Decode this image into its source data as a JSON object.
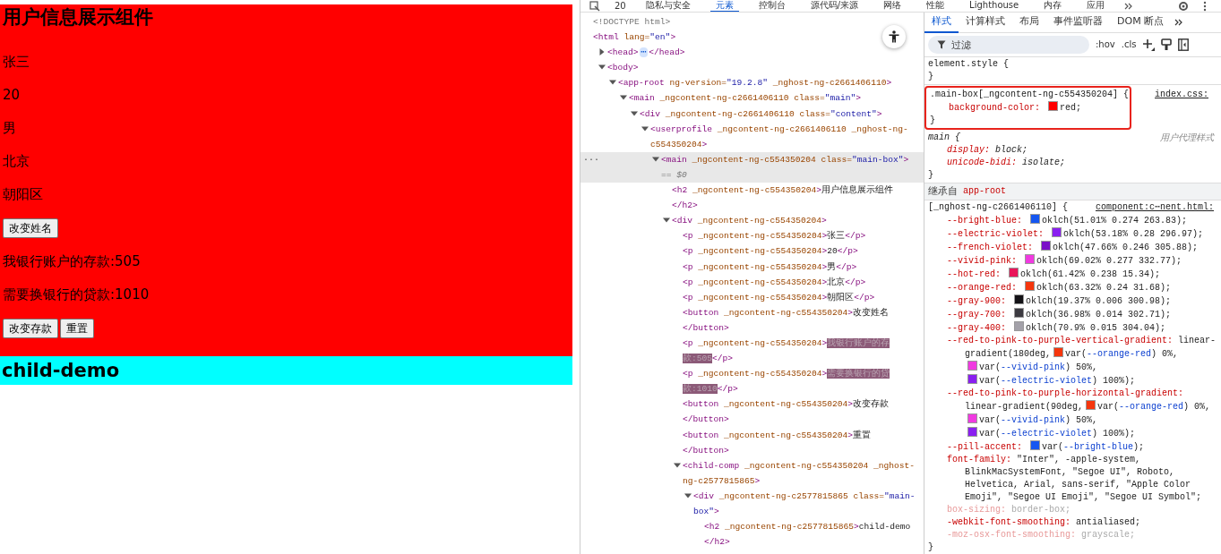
{
  "page": {
    "heading": "用户信息展示组件",
    "content": [
      {
        "kind": "text",
        "text": "张三"
      },
      {
        "kind": "text",
        "text": "20"
      },
      {
        "kind": "text",
        "text": "男"
      },
      {
        "kind": "text",
        "text": "北京"
      },
      {
        "kind": "text",
        "text": "朝阳区"
      },
      {
        "kind": "buttons",
        "buttons": [
          "改变姓名"
        ]
      },
      {
        "kind": "text",
        "text": "我银行账户的存款:505"
      },
      {
        "kind": "text",
        "text": "需要换银行的贷款:1010"
      },
      {
        "kind": "buttons",
        "buttons": [
          "改变存款",
          "重置"
        ]
      }
    ],
    "child": {
      "heading": "child-demo"
    }
  },
  "devtools": {
    "issue_count": "20",
    "tabs": [
      {
        "label": "隐私与安全",
        "selected": false
      },
      {
        "label": "元素",
        "selected": true
      },
      {
        "label": "控制台",
        "selected": false
      },
      {
        "label": "源代码/来源",
        "selected": false
      },
      {
        "label": "网络",
        "selected": false
      },
      {
        "label": "性能",
        "selected": false
      },
      {
        "label": "Lighthouse",
        "selected": false
      },
      {
        "label": "内存",
        "selected": false
      },
      {
        "label": "应用",
        "selected": false
      }
    ]
  },
  "elements": {
    "tree": [
      {
        "selected": false,
        "tokens": [
          {
            "kind": "muted",
            "text": "<!DOCTYPE html>"
          }
        ]
      },
      {
        "selected": false,
        "tokens": [
          {
            "kind": "tag",
            "text": "<html"
          },
          {
            "kind": "attr",
            "text": " lang="
          },
          {
            "kind": "value",
            "text": "\"en\""
          },
          {
            "kind": "tag",
            "text": ">"
          }
        ],
        "children": [
          {
            "selected": false,
            "expanded": false,
            "tokens": [
              {
                "kind": "tag",
                "text": "<head>"
              },
              {
                "kind": "badge",
                "text": "⋯"
              },
              {
                "kind": "tag",
                "text": "</head>"
              }
            ]
          },
          {
            "selected": false,
            "expanded": true,
            "tokens": [
              {
                "kind": "tag",
                "text": "<body>"
              }
            ],
            "children": [
              {
                "selected": false,
                "expanded": true,
                "tokens": [
                  {
                    "kind": "tag",
                    "text": "<app-root"
                  },
                  {
                    "kind": "attr",
                    "text": " ng-version="
                  },
                  {
                    "kind": "value",
                    "text": "\"19.2.8\""
                  },
                  {
                    "kind": "attr",
                    "text": " _nghost-ng-c2661406110"
                  },
                  {
                    "kind": "tag",
                    "text": ">"
                  }
                ],
                "children": [
                  {
                    "selected": false,
                    "expanded": true,
                    "tokens": [
                      {
                        "kind": "tag",
                        "text": "<main"
                      },
                      {
                        "kind": "attr",
                        "text": " _ngcontent-ng-c2661406110 class="
                      },
                      {
                        "kind": "value",
                        "text": "\"main\""
                      },
                      {
                        "kind": "tag",
                        "text": ">"
                      }
                    ],
                    "children": [
                      {
                        "selected": false,
                        "expanded": true,
                        "tokens": [
                          {
                            "kind": "tag",
                            "text": "<div"
                          },
                          {
                            "kind": "attr",
                            "text": " _ngcontent-ng-c2661406110 class="
                          },
                          {
                            "kind": "value",
                            "text": "\"content\""
                          },
                          {
                            "kind": "tag",
                            "text": ">"
                          }
                        ],
                        "children": [
                          {
                            "selected": false,
                            "expanded": true,
                            "tokens": [
                              {
                                "kind": "tag",
                                "text": "<userprofile"
                              },
                              {
                                "kind": "attr",
                                "text": " _ngcontent-ng-c2661406110 _nghost-ng-c554350204"
                              },
                              {
                                "kind": "tag",
                                "text": ">"
                              }
                            ],
                            "children": [
                              {
                                "selected": true,
                                "marker": "···",
                                "expanded": true,
                                "tokens": [
                                  {
                                    "kind": "tag",
                                    "text": "<main"
                                  },
                                  {
                                    "kind": "attr",
                                    "text": " _ngcontent-ng-c554350204 class="
                                  },
                                  {
                                    "kind": "value",
                                    "text": "\"main-box\""
                                  },
                                  {
                                    "kind": "tag",
                                    "text": ">"
                                  },
                                  {
                                    "kind": "ref",
                                    "text": " == $0"
                                  }
                                ],
                                "children": [
                                  {
                                    "selected": false,
                                    "tokens": [
                                      {
                                        "kind": "tag",
                                        "text": "<h2"
                                      },
                                      {
                                        "kind": "attr",
                                        "text": " _ngcontent-ng-c554350204"
                                      },
                                      {
                                        "kind": "tag",
                                        "text": ">"
                                      },
                                      {
                                        "kind": "text",
                                        "text": "用户信息展示组件"
                                      },
                                      {
                                        "kind": "break"
                                      },
                                      {
                                        "kind": "tag",
                                        "text": "</h2>"
                                      }
                                    ]
                                  },
                                  {
                                    "selected": false,
                                    "expanded": true,
                                    "tokens": [
                                      {
                                        "kind": "tag",
                                        "text": "<div"
                                      },
                                      {
                                        "kind": "attr",
                                        "text": " _ngcontent-ng-c554350204"
                                      },
                                      {
                                        "kind": "tag",
                                        "text": ">"
                                      }
                                    ],
                                    "children": [
                                      {
                                        "selected": false,
                                        "tokens": [
                                          {
                                            "kind": "tag",
                                            "text": "<p"
                                          },
                                          {
                                            "kind": "attr",
                                            "text": " _ngcontent-ng-c554350204"
                                          },
                                          {
                                            "kind": "tag",
                                            "text": ">"
                                          },
                                          {
                                            "kind": "text",
                                            "text": "张三"
                                          },
                                          {
                                            "kind": "tag",
                                            "text": "</p>"
                                          }
                                        ]
                                      },
                                      {
                                        "selected": false,
                                        "tokens": [
                                          {
                                            "kind": "tag",
                                            "text": "<p"
                                          },
                                          {
                                            "kind": "attr",
                                            "text": " _ngcontent-ng-c554350204"
                                          },
                                          {
                                            "kind": "tag",
                                            "text": ">"
                                          },
                                          {
                                            "kind": "text",
                                            "text": "20"
                                          },
                                          {
                                            "kind": "tag",
                                            "text": "</p>"
                                          }
                                        ]
                                      },
                                      {
                                        "selected": false,
                                        "tokens": [
                                          {
                                            "kind": "tag",
                                            "text": "<p"
                                          },
                                          {
                                            "kind": "attr",
                                            "text": " _ngcontent-ng-c554350204"
                                          },
                                          {
                                            "kind": "tag",
                                            "text": ">"
                                          },
                                          {
                                            "kind": "text",
                                            "text": "男"
                                          },
                                          {
                                            "kind": "tag",
                                            "text": "</p>"
                                          }
                                        ]
                                      },
                                      {
                                        "selected": false,
                                        "tokens": [
                                          {
                                            "kind": "tag",
                                            "text": "<p"
                                          },
                                          {
                                            "kind": "attr",
                                            "text": " _ngcontent-ng-c554350204"
                                          },
                                          {
                                            "kind": "tag",
                                            "text": ">"
                                          },
                                          {
                                            "kind": "text",
                                            "text": "北京"
                                          },
                                          {
                                            "kind": "tag",
                                            "text": "</p>"
                                          }
                                        ]
                                      },
                                      {
                                        "selected": false,
                                        "tokens": [
                                          {
                                            "kind": "tag",
                                            "text": "<p"
                                          },
                                          {
                                            "kind": "attr",
                                            "text": " _ngcontent-ng-c554350204"
                                          },
                                          {
                                            "kind": "tag",
                                            "text": ">"
                                          },
                                          {
                                            "kind": "text",
                                            "text": "朝阳区"
                                          },
                                          {
                                            "kind": "tag",
                                            "text": "</p>"
                                          }
                                        ]
                                      },
                                      {
                                        "selected": false,
                                        "tokens": [
                                          {
                                            "kind": "tag",
                                            "text": "<button"
                                          },
                                          {
                                            "kind": "attr",
                                            "text": " _ngcontent-ng-c554350204"
                                          },
                                          {
                                            "kind": "tag",
                                            "text": ">"
                                          },
                                          {
                                            "kind": "text",
                                            "text": "改变姓名"
                                          },
                                          {
                                            "kind": "break"
                                          },
                                          {
                                            "kind": "tag",
                                            "text": "</button>"
                                          }
                                        ]
                                      },
                                      {
                                        "selected": false,
                                        "tokens": [
                                          {
                                            "kind": "tag",
                                            "text": "<p"
                                          },
                                          {
                                            "kind": "attr",
                                            "text": " _ngcontent-ng-c554350204"
                                          },
                                          {
                                            "kind": "tag",
                                            "text": ">"
                                          },
                                          {
                                            "kind": "mark",
                                            "text": "我银行账户的存款:505"
                                          },
                                          {
                                            "kind": "tag",
                                            "text": "</p>"
                                          }
                                        ]
                                      },
                                      {
                                        "selected": false,
                                        "tokens": [
                                          {
                                            "kind": "tag",
                                            "text": "<p"
                                          },
                                          {
                                            "kind": "attr",
                                            "text": " _ngcontent-ng-c554350204"
                                          },
                                          {
                                            "kind": "tag",
                                            "text": ">"
                                          },
                                          {
                                            "kind": "mark",
                                            "text": "需要换银行的贷款:1010"
                                          },
                                          {
                                            "kind": "tag",
                                            "text": "</p>"
                                          }
                                        ]
                                      },
                                      {
                                        "selected": false,
                                        "tokens": [
                                          {
                                            "kind": "tag",
                                            "text": "<button"
                                          },
                                          {
                                            "kind": "attr",
                                            "text": " _ngcontent-ng-c554350204"
                                          },
                                          {
                                            "kind": "tag",
                                            "text": ">"
                                          },
                                          {
                                            "kind": "text",
                                            "text": "改变存款"
                                          },
                                          {
                                            "kind": "break"
                                          },
                                          {
                                            "kind": "tag",
                                            "text": "</button>"
                                          }
                                        ]
                                      },
                                      {
                                        "selected": false,
                                        "tokens": [
                                          {
                                            "kind": "tag",
                                            "text": "<button"
                                          },
                                          {
                                            "kind": "attr",
                                            "text": " _ngcontent-ng-c554350204"
                                          },
                                          {
                                            "kind": "tag",
                                            "text": ">"
                                          },
                                          {
                                            "kind": "text",
                                            "text": "重置"
                                          },
                                          {
                                            "kind": "break"
                                          },
                                          {
                                            "kind": "tag",
                                            "text": "</button>"
                                          }
                                        ]
                                      },
                                      {
                                        "selected": false,
                                        "expanded": true,
                                        "tokens": [
                                          {
                                            "kind": "tag",
                                            "text": "<child-comp"
                                          },
                                          {
                                            "kind": "attr",
                                            "text": " _ngcontent-ng-c554350204 _nghost-ng-c2577815865"
                                          },
                                          {
                                            "kind": "tag",
                                            "text": ">"
                                          }
                                        ],
                                        "children": [
                                          {
                                            "selected": false,
                                            "expanded": true,
                                            "tokens": [
                                              {
                                                "kind": "tag",
                                                "text": "<div"
                                              },
                                              {
                                                "kind": "attr",
                                                "text": " _ngcontent-ng-c2577815865 class="
                                              },
                                              {
                                                "kind": "value",
                                                "text": "\"main-box\""
                                              },
                                              {
                                                "kind": "tag",
                                                "text": ">"
                                              }
                                            ],
                                            "children": [
                                              {
                                                "selected": false,
                                                "tokens": [
                                                  {
                                                    "kind": "tag",
                                                    "text": "<h2"
                                                  },
                                                  {
                                                    "kind": "attr",
                                                    "text": " _ngcontent-ng-c2577815865"
                                                  },
                                                  {
                                                    "kind": "tag",
                                                    "text": ">"
                                                  },
                                                  {
                                                    "kind": "text",
                                                    "text": "child-demo"
                                                  },
                                                  {
                                                    "kind": "break"
                                                  },
                                                  {
                                                    "kind": "tag",
                                                    "text": "</h2>"
                                                  }
                                                ]
                                              }
                                            ]
                                          }
                                        ]
                                      }
                                    ]
                                  }
                                ]
                              }
                            ]
                          }
                        ]
                      }
                    ]
                  }
                ]
              }
            ]
          }
        ]
      }
    ]
  },
  "styles": {
    "tabs": [
      {
        "label": "样式",
        "selected": true
      },
      {
        "label": "计算样式",
        "selected": false
      },
      {
        "label": "布局",
        "selected": false
      },
      {
        "label": "事件监听器",
        "selected": false
      },
      {
        "label": "DOM 断点",
        "selected": false
      }
    ],
    "filter": {
      "placeholder": "过滤"
    },
    "toggles": [
      ":hov",
      ".cls"
    ],
    "sections": [
      {
        "rules": [
          {
            "kind": "author",
            "highlighted": false,
            "selector": "element.style {",
            "close": "}"
          },
          {
            "kind": "author",
            "highlighted": true,
            "selector": ".main-box[_ngcontent-ng-c554350204] {",
            "source": "index.css:",
            "close": "}",
            "declarations": [
              {
                "name": "background-color:",
                "inactive": false,
                "value": [
                  {
                    "kind": "swatch",
                    "color": "#ff0000"
                  },
                  {
                    "kind": "text",
                    "text": "red;"
                  }
                ]
              }
            ]
          },
          {
            "kind": "user-agent",
            "highlighted": false,
            "selector": "main {",
            "source": "用户代理样式",
            "close": "}",
            "declarations": [
              {
                "name": "display:",
                "inactive": false,
                "value": [
                  {
                    "kind": "text",
                    "text": "block;"
                  }
                ]
              },
              {
                "name": "unicode-bidi:",
                "inactive": false,
                "value": [
                  {
                    "kind": "text",
                    "text": "isolate;"
                  }
                ]
              }
            ]
          }
        ]
      },
      {
        "header": {
          "label": "继承自",
          "from": "app-root"
        },
        "rules": [
          {
            "kind": "author",
            "highlighted": false,
            "selector": "[_nghost-ng-c2661406110] {",
            "source": "component:c⋯nent.html:",
            "close": "}",
            "declarations": [
              {
                "name": "--bright-blue:",
                "inactive": false,
                "value": [
                  {
                    "kind": "swatch",
                    "color": "#1556f0"
                  },
                  {
                    "kind": "text",
                    "text": "oklch(51.01% 0.274 263.83);"
                  }
                ]
              },
              {
                "name": "--electric-violet:",
                "inactive": false,
                "value": [
                  {
                    "kind": "swatch",
                    "color": "#8a1ff0"
                  },
                  {
                    "kind": "text",
                    "text": "oklch(53.18% 0.28 296.97);"
                  }
                ]
              },
              {
                "name": "--french-violet:",
                "inactive": false,
                "value": [
                  {
                    "kind": "swatch",
                    "color": "#7a10c8"
                  },
                  {
                    "kind": "text",
                    "text": "oklch(47.66% 0.246 305.88);"
                  }
                ]
              },
              {
                "name": "--vivid-pink:",
                "inactive": false,
                "value": [
                  {
                    "kind": "swatch",
                    "color": "#f03ae0"
                  },
                  {
                    "kind": "text",
                    "text": "oklch(69.02% 0.277 332.77);"
                  }
                ]
              },
              {
                "name": "--hot-red:",
                "inactive": false,
                "value": [
                  {
                    "kind": "swatch",
                    "color": "#ea155a"
                  },
                  {
                    "kind": "text",
                    "text": "oklch(61.42% 0.238 15.34);"
                  }
                ]
              },
              {
                "name": "--orange-red:",
                "inactive": false,
                "value": [
                  {
                    "kind": "swatch",
                    "color": "#f5360d"
                  },
                  {
                    "kind": "text",
                    "text": "oklch(63.32% 0.24 31.68);"
                  }
                ]
              },
              {
                "name": "--gray-900:",
                "inactive": false,
                "value": [
                  {
                    "kind": "swatch",
                    "color": "#141216"
                  },
                  {
                    "kind": "text",
                    "text": "oklch(19.37% 0.006 300.98);"
                  }
                ]
              },
              {
                "name": "--gray-700:",
                "inactive": false,
                "value": [
                  {
                    "kind": "swatch",
                    "color": "#3c3a41"
                  },
                  {
                    "kind": "text",
                    "text": "oklch(36.98% 0.014 302.71);"
                  }
                ]
              },
              {
                "name": "--gray-400:",
                "inactive": false,
                "value": [
                  {
                    "kind": "swatch",
                    "color": "#a3a1a9"
                  },
                  {
                    "kind": "text",
                    "text": "oklch(70.9% 0.015 304.04);"
                  }
                ]
              },
              {
                "name": "--red-to-pink-to-purple-vertical-gradient:",
                "inactive": false,
                "value": [
                  {
                    "kind": "text",
                    "text": "linear-"
                  },
                  {
                    "kind": "break"
                  },
                  {
                    "kind": "text",
                    "text": "gradient(180deg,"
                  },
                  {
                    "kind": "swatch",
                    "color": "#f5360d"
                  },
                  {
                    "kind": "text",
                    "text": "var("
                  },
                  {
                    "kind": "var",
                    "text": "--orange-red"
                  },
                  {
                    "kind": "text",
                    "text": ") 0%,"
                  },
                  {
                    "kind": "break"
                  },
                  {
                    "kind": "swatch",
                    "color": "#f03ae0"
                  },
                  {
                    "kind": "text",
                    "text": "var("
                  },
                  {
                    "kind": "var",
                    "text": "--vivid-pink"
                  },
                  {
                    "kind": "text",
                    "text": ") 50%,"
                  },
                  {
                    "kind": "break"
                  },
                  {
                    "kind": "swatch",
                    "color": "#8a1ff0"
                  },
                  {
                    "kind": "text",
                    "text": "var("
                  },
                  {
                    "kind": "var",
                    "text": "--electric-violet"
                  },
                  {
                    "kind": "text",
                    "text": ") 100%);"
                  }
                ]
              },
              {
                "name": "--red-to-pink-to-purple-horizontal-gradient:",
                "inactive": false,
                "value": [
                  {
                    "kind": "break"
                  },
                  {
                    "kind": "text",
                    "text": "linear-gradient(90deg,"
                  },
                  {
                    "kind": "swatch",
                    "color": "#f5360d"
                  },
                  {
                    "kind": "text",
                    "text": "var("
                  },
                  {
                    "kind": "var",
                    "text": "--orange-red"
                  },
                  {
                    "kind": "text",
                    "text": ") 0%,"
                  },
                  {
                    "kind": "break"
                  },
                  {
                    "kind": "swatch",
                    "color": "#f03ae0"
                  },
                  {
                    "kind": "text",
                    "text": "var("
                  },
                  {
                    "kind": "var",
                    "text": "--vivid-pink"
                  },
                  {
                    "kind": "text",
                    "text": ") 50%,"
                  },
                  {
                    "kind": "break"
                  },
                  {
                    "kind": "swatch",
                    "color": "#8a1ff0"
                  },
                  {
                    "kind": "text",
                    "text": "var("
                  },
                  {
                    "kind": "var",
                    "text": "--electric-violet"
                  },
                  {
                    "kind": "text",
                    "text": ") 100%);"
                  }
                ]
              },
              {
                "name": "--pill-accent:",
                "inactive": false,
                "value": [
                  {
                    "kind": "swatch",
                    "color": "#1556f0"
                  },
                  {
                    "kind": "text",
                    "text": "var("
                  },
                  {
                    "kind": "var",
                    "text": "--bright-blue"
                  },
                  {
                    "kind": "text",
                    "text": ");"
                  }
                ]
              },
              {
                "name": "font-family:",
                "inactive": false,
                "value": [
                  {
                    "kind": "text",
                    "text": "\"Inter\", -apple-system,"
                  },
                  {
                    "kind": "break"
                  },
                  {
                    "kind": "text",
                    "text": "BlinkMacSystemFont, \"Segoe UI\", Roboto,"
                  },
                  {
                    "kind": "break"
                  },
                  {
                    "kind": "text",
                    "text": "Helvetica, Arial, sans-serif, \"Apple Color"
                  },
                  {
                    "kind": "break"
                  },
                  {
                    "kind": "text",
                    "text": "Emoji\", \"Segoe UI Emoji\", \"Segoe UI Symbol\";"
                  }
                ]
              },
              {
                "name": "box-sizing:",
                "inactive": true,
                "value": [
                  {
                    "kind": "text",
                    "text": "border-box;"
                  }
                ]
              },
              {
                "name": "-webkit-font-smoothing:",
                "inactive": false,
                "value": [
                  {
                    "kind": "text",
                    "text": "antialiased;"
                  }
                ]
              },
              {
                "name": "-moz-osx-font-smoothing:",
                "inactive": true,
                "value": [
                  {
                    "kind": "text",
                    "text": "grayscale;"
                  }
                ]
              }
            ]
          }
        ]
      }
    ]
  }
}
